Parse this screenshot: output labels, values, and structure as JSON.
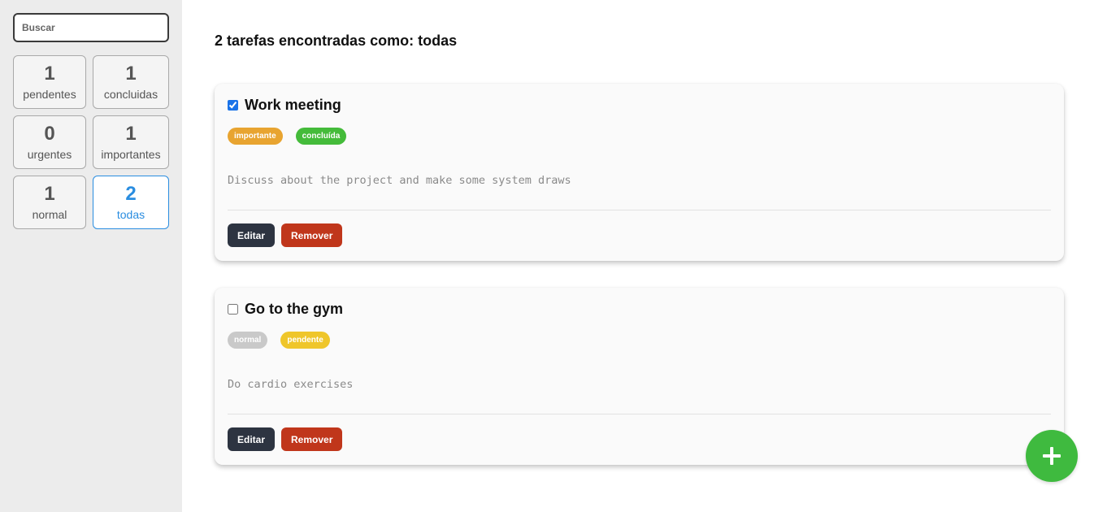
{
  "sidebar": {
    "search": {
      "placeholder": "Buscar",
      "value": ""
    },
    "filters": [
      {
        "count": "1",
        "label": "pendentes"
      },
      {
        "count": "1",
        "label": "concluidas"
      },
      {
        "count": "0",
        "label": "urgentes"
      },
      {
        "count": "1",
        "label": "importantes"
      },
      {
        "count": "1",
        "label": "normal"
      },
      {
        "count": "2",
        "label": "todas"
      }
    ],
    "active_filter": "todas"
  },
  "main": {
    "heading": "2 tarefas encontradas como: todas",
    "tasks": [
      {
        "title": "Work meeting",
        "checked": true,
        "tags": [
          {
            "label": "importante",
            "color": "#e8a430"
          },
          {
            "label": "concluída",
            "color": "#44bb3a"
          }
        ],
        "description": "Discuss about the project and make some system draws",
        "edit_label": "Editar",
        "remove_label": "Remover"
      },
      {
        "title": "Go to the gym",
        "checked": false,
        "tags": [
          {
            "label": "normal",
            "color": "#c9c9c9"
          },
          {
            "label": "pendente",
            "color": "#efc62a"
          }
        ],
        "description": "Do cardio exercises",
        "edit_label": "Editar",
        "remove_label": "Remover"
      }
    ]
  },
  "fab": {
    "icon": "plus-icon",
    "color": "#3fba3f"
  },
  "colors": {
    "accent": "#2a8de0",
    "edit_button": "#2d3441",
    "remove_button": "#c0361b"
  }
}
